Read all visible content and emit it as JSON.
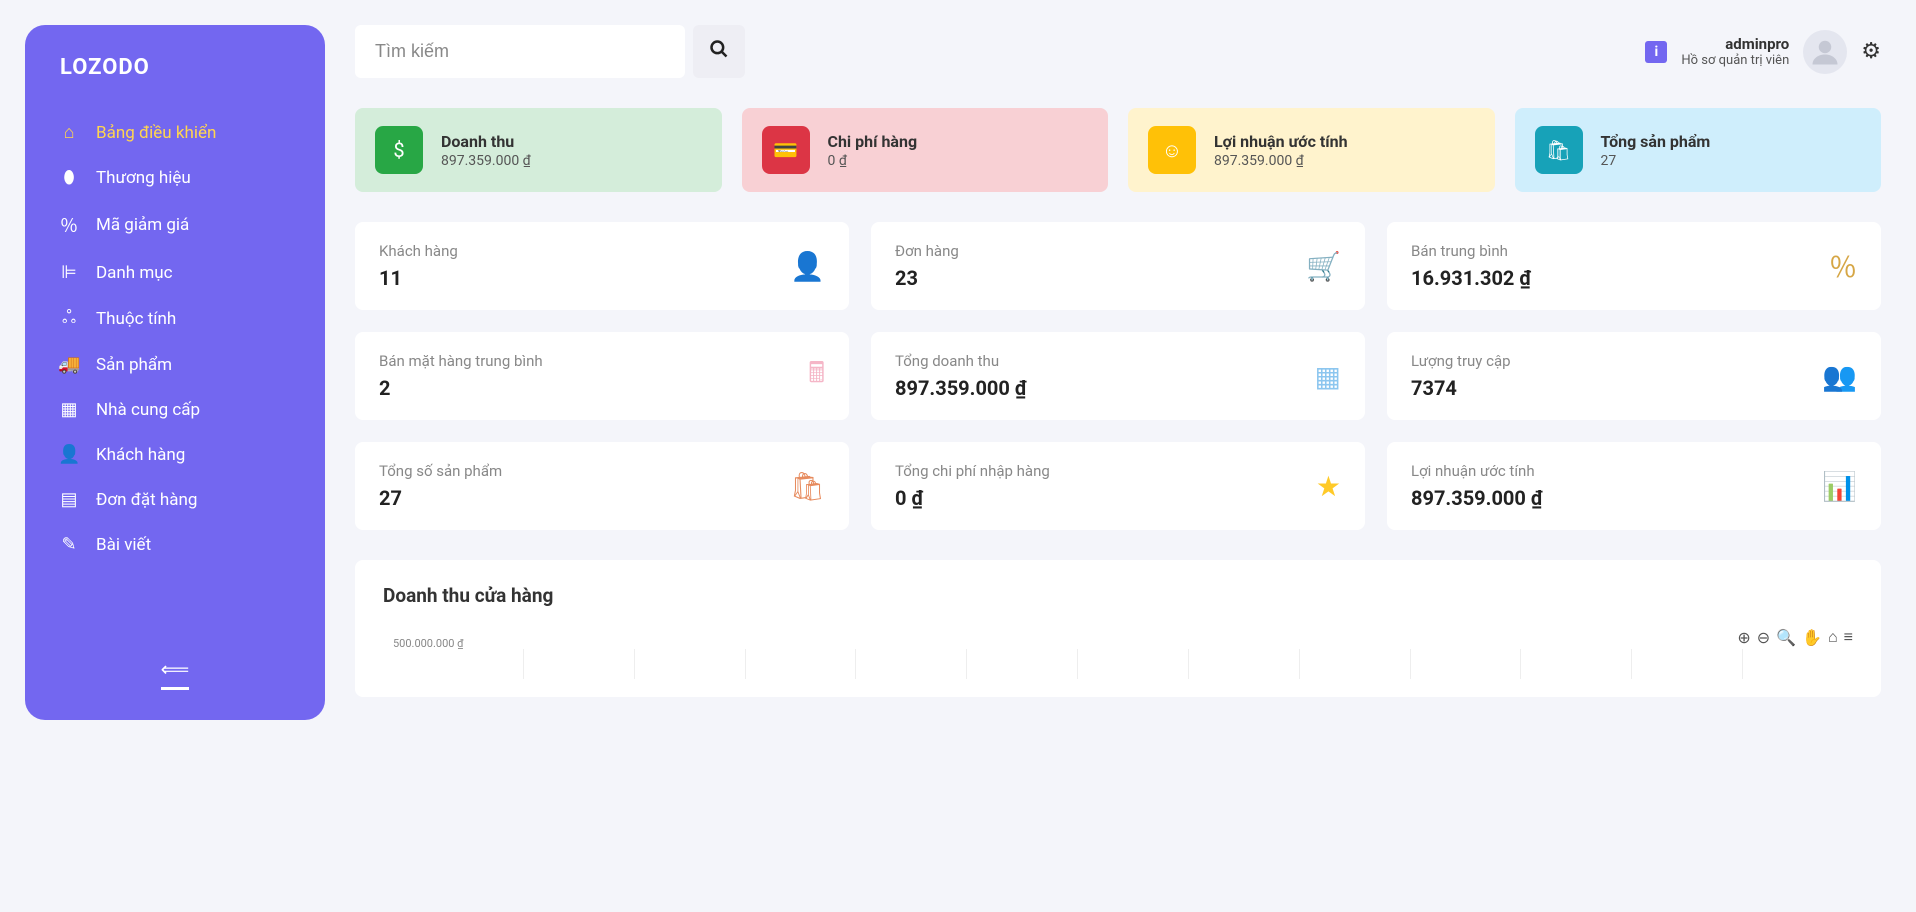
{
  "brand": "LOZODO",
  "sidebar": {
    "items": [
      {
        "label": "Bảng điều khiển",
        "icon": "home-icon",
        "glyph": "⌂",
        "active": true
      },
      {
        "label": "Thương hiệu",
        "icon": "egg-icon",
        "glyph": "⬮",
        "active": false
      },
      {
        "label": "Mã giảm giá",
        "icon": "percent-icon",
        "glyph": "％",
        "active": false
      },
      {
        "label": "Danh mục",
        "icon": "category-icon",
        "glyph": "⊫",
        "active": false
      },
      {
        "label": "Thuộc tính",
        "icon": "attribute-icon",
        "glyph": "ஃ",
        "active": false
      },
      {
        "label": "Sản phẩm",
        "icon": "truck-icon",
        "glyph": "🚚",
        "active": false
      },
      {
        "label": "Nhà cung cấp",
        "icon": "grid-icon",
        "glyph": "▦",
        "active": false
      },
      {
        "label": "Khách hàng",
        "icon": "user-icon",
        "glyph": "👤",
        "active": false
      },
      {
        "label": "Đơn đặt hàng",
        "icon": "document-icon",
        "glyph": "▤",
        "active": false
      },
      {
        "label": "Bài viết",
        "icon": "edit-icon",
        "glyph": "✎",
        "active": false
      }
    ]
  },
  "search": {
    "placeholder": "Tìm kiếm"
  },
  "user": {
    "name": "adminpro",
    "subtitle": "Hồ sơ quản trị viên",
    "info_badge": "i"
  },
  "summary": [
    {
      "title": "Doanh thu",
      "value": "897.359.000 ₫",
      "color": "green",
      "glyph": "$"
    },
    {
      "title": "Chi phí hàng",
      "value": "0 ₫",
      "color": "red",
      "glyph": "💳"
    },
    {
      "title": "Lợi nhuận ước tính",
      "value": "897.359.000 ₫",
      "color": "yellow",
      "glyph": "☺"
    },
    {
      "title": "Tổng sản phẩm",
      "value": "27",
      "color": "blue",
      "glyph": "🛍"
    }
  ],
  "stats": [
    {
      "label": "Khách hàng",
      "value": "11",
      "glyph": "👤",
      "cls": "i-orange"
    },
    {
      "label": "Đơn hàng",
      "value": "23",
      "glyph": "🛒",
      "cls": "i-purple"
    },
    {
      "label": "Bán trung bình",
      "value": "16.931.302 ₫",
      "glyph": "％",
      "cls": "i-dyellow"
    },
    {
      "label": "Bán mặt hàng trung bình",
      "value": "2",
      "glyph": "🖩",
      "cls": "i-pink"
    },
    {
      "label": "Tổng doanh thu",
      "value": "897.359.000 ₫",
      "glyph": "▦",
      "cls": "i-lblue"
    },
    {
      "label": "Lượng truy cập",
      "value": "7374",
      "glyph": "👥",
      "cls": "i-green"
    },
    {
      "label": "Tổng số sản phẩm",
      "value": "27",
      "glyph": "🛍",
      "cls": "i-dorange"
    },
    {
      "label": "Tổng chi phí nhập hàng",
      "value": "0 ₫",
      "glyph": "★",
      "cls": "i-yellow"
    },
    {
      "label": "Lợi nhuận ước tính",
      "value": "897.359.000 ₫",
      "glyph": "📊",
      "cls": "i-teal"
    }
  ],
  "chart": {
    "title": "Doanh thu cửa hàng"
  },
  "chart_data": {
    "type": "bar",
    "title": "Doanh thu cửa hàng",
    "xlabel": "",
    "ylabel": "₫",
    "ylim": [
      0,
      500000000
    ],
    "yticks": [
      "500.000.000 ₫"
    ],
    "categories": [],
    "values": []
  },
  "chart_toolbar": {
    "zoom_in": "⊕",
    "zoom_out": "⊖",
    "zoom_sel": "🔍",
    "pan": "✋",
    "home": "⌂",
    "menu": "≡"
  }
}
